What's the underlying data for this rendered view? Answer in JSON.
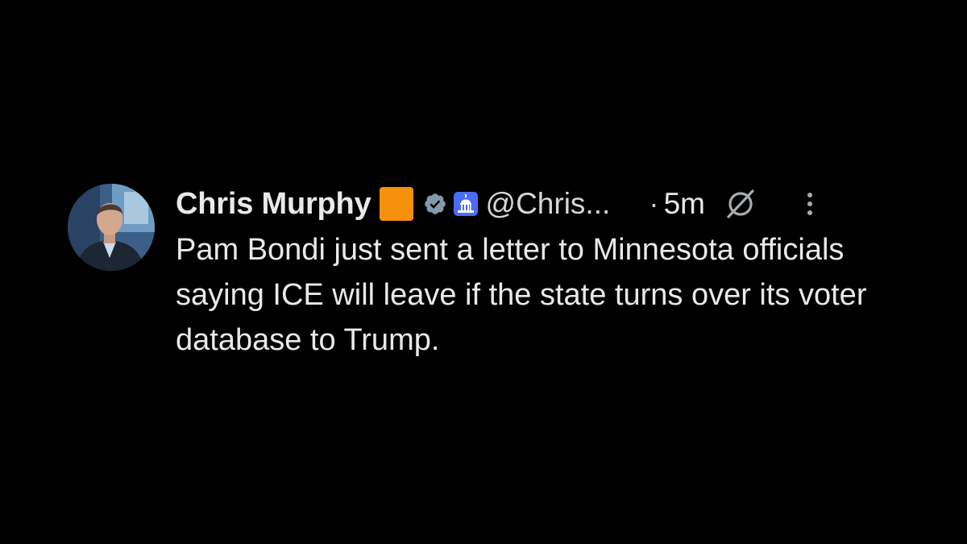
{
  "tweet": {
    "author_name": "Chris Murphy",
    "handle": "@Chris...",
    "separator": "·",
    "timestamp": "5m",
    "text": "Pam Bondi just sent a letter to Minnesota officials saying ICE will leave if the state turns over its voter database to Trump.",
    "icons": {
      "flag": "orange-square-icon",
      "verified": "verified-badge-icon",
      "affiliation": "capitol-building-icon",
      "grok": "grok-icon",
      "more": "more-options-icon"
    },
    "colors": {
      "background": "#000000",
      "text": "#e7e9ea",
      "flag": "#f4900c",
      "verified": "#829aab",
      "affiliation": "#4a6cf7"
    }
  }
}
